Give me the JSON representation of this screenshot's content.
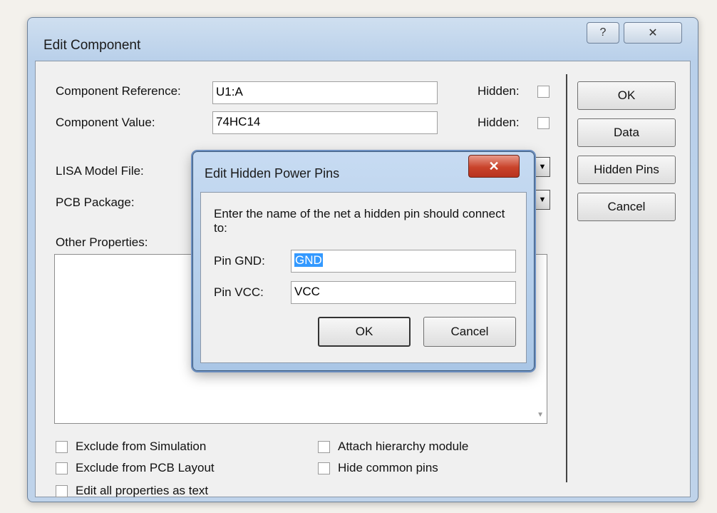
{
  "edit_component": {
    "title": "Edit Component",
    "help_glyph": "?",
    "close_glyph": "✕",
    "component_reference_label": "Component Reference:",
    "component_reference_value": "U1:A",
    "component_value_label": "Component Value:",
    "component_value_value": "74HC14",
    "hidden_label": "Hidden:",
    "lisa_model_file_label": "LISA Model File:",
    "pcb_package_label": "PCB Package:",
    "other_properties_label": "Other Properties:",
    "buttons": {
      "ok": "OK",
      "data": "Data",
      "hidden_pins": "Hidden Pins",
      "cancel": "Cancel"
    },
    "checkboxes": {
      "exclude_simulation": "Exclude from Simulation",
      "exclude_pcb": "Exclude from PCB Layout",
      "edit_as_text": "Edit all properties as text",
      "attach_module": "Attach hierarchy module",
      "hide_common_pins": "Hide common pins"
    }
  },
  "hidden_pins_dialog": {
    "title": "Edit Hidden Power Pins",
    "close_glyph": "✕",
    "prompt": "Enter the name of the net a hidden pin should connect to:",
    "pin_gnd_label": "Pin GND:",
    "pin_gnd_value": "GND",
    "pin_vcc_label": "Pin VCC:",
    "pin_vcc_value": "VCC",
    "ok": "OK",
    "cancel": "Cancel"
  }
}
